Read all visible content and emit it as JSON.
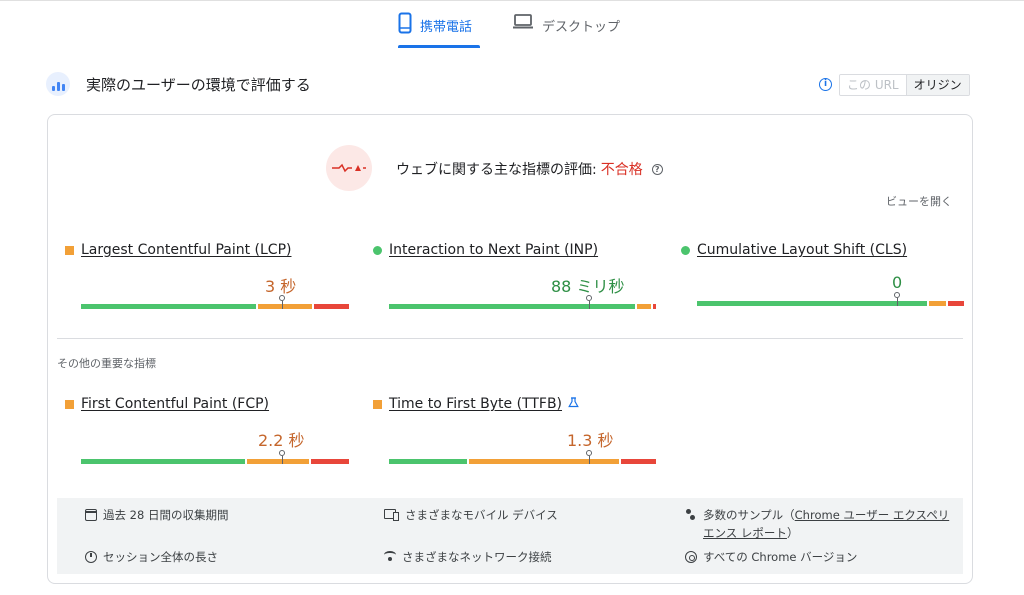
{
  "tabs": {
    "mobile": {
      "label": "携帯電話",
      "icon": "smartphone-icon",
      "active": true
    },
    "desktop": {
      "label": "デスクトップ",
      "icon": "laptop-icon",
      "active": false
    }
  },
  "section": {
    "title": "実際のユーザーの環境で評価する",
    "icon": "field-data-icon",
    "toggle": {
      "url_label": "この URL",
      "origin_label": "オリジン",
      "selected": "origin"
    }
  },
  "assessment": {
    "label": "ウェブに関する主な指標の評価:",
    "result": "不合格",
    "icon": "failed-assessment-icon",
    "expand_label": "ビューを開く"
  },
  "core_metrics": [
    {
      "name": "Largest Contentful Paint (LCP)",
      "value": "3 秒",
      "rating": "orange",
      "distribution": [
        66,
        21,
        13
      ],
      "marker": 0.75
    },
    {
      "name": "Interaction to Next Paint (INP)",
      "value": "88 ミリ秒",
      "rating": "green",
      "distribution": [
        93,
        6,
        1
      ],
      "marker": 0.75
    },
    {
      "name": "Cumulative Layout Shift (CLS)",
      "value": "0",
      "rating": "green",
      "distribution": [
        87,
        7,
        6
      ],
      "marker": 0.75
    }
  ],
  "other_title": "その他の重要な指標",
  "other_metrics": [
    {
      "name": "First Contentful Paint (FCP)",
      "value": "2.2 秒",
      "rating": "orange",
      "distribution": [
        62,
        24,
        14
      ],
      "marker": 0.75,
      "experimental": false
    },
    {
      "name": "Time to First Byte (TTFB)",
      "value": "1.3 秒",
      "rating": "orange",
      "distribution": [
        30,
        57,
        13
      ],
      "marker": 0.75,
      "experimental": true
    }
  ],
  "footer": {
    "period": "過去 28 日間の収集期間",
    "devices": "さまざまなモバイル デバイス",
    "samples_prefix": "多数のサンプル（",
    "samples_link": "Chrome ユーザー エクスペリエンス レポート",
    "samples_suffix": "）",
    "duration": "セッション全体の長さ",
    "network": "さまざまなネットワーク接続",
    "chrome": "すべての Chrome バージョン"
  },
  "colors": {
    "good": "#4bc46d",
    "needs_improvement": "#f2a037",
    "poor": "#e8463a",
    "accent": "#1a73e8",
    "fail": "#d93025"
  }
}
